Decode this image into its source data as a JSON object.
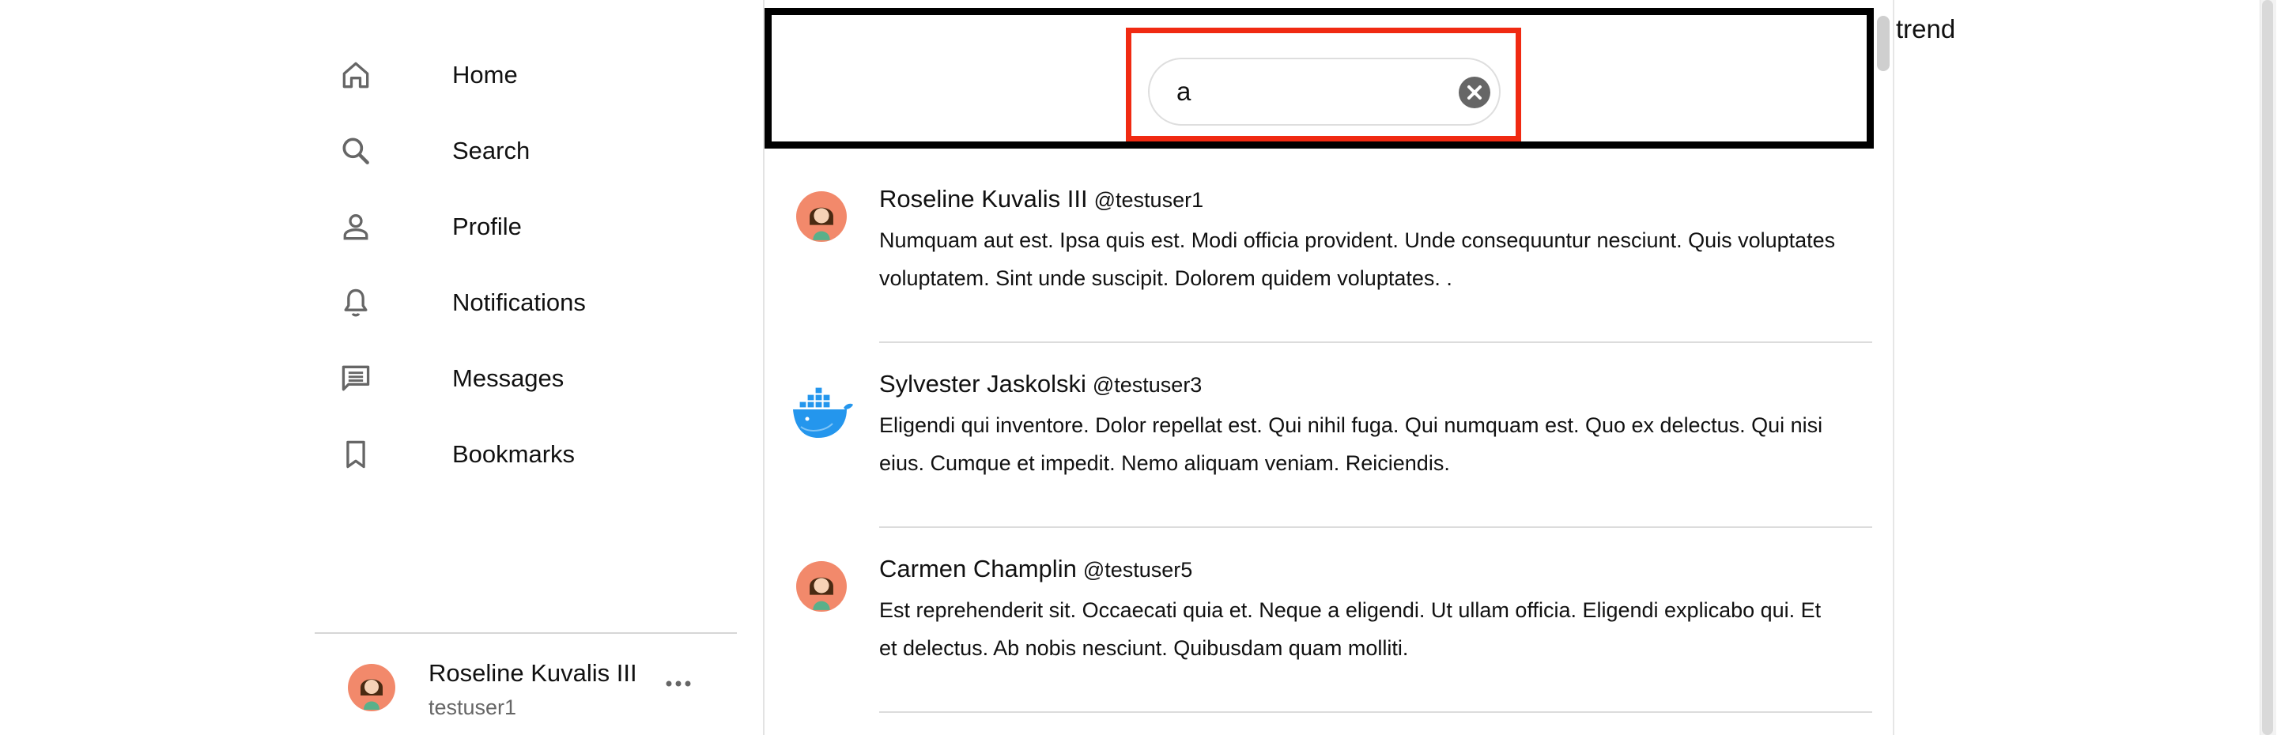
{
  "nav": {
    "items": [
      {
        "label": "Home",
        "icon": "home-icon"
      },
      {
        "label": "Search",
        "icon": "search-icon"
      },
      {
        "label": "Profile",
        "icon": "person-icon"
      },
      {
        "label": "Notifications",
        "icon": "bell-icon"
      },
      {
        "label": "Messages",
        "icon": "message-icon"
      },
      {
        "label": "Bookmarks",
        "icon": "bookmark-icon"
      }
    ]
  },
  "account": {
    "name": "Roseline Kuvalis III",
    "handle": "testuser1",
    "more_icon": "more-horizontal-icon"
  },
  "search": {
    "value": "a",
    "clear_icon": "clear-circle-icon"
  },
  "results": [
    {
      "author": "Roseline Kuvalis III",
      "handle": "@testuser1",
      "avatar": "woman-avatar",
      "text": "Numquam aut est. Ipsa quis est. Modi officia provident. Unde consequuntur nesciunt. Quis voluptates voluptatem. Sint unde suscipit. Dolorem quidem voluptates. ."
    },
    {
      "author": "Sylvester Jaskolski",
      "handle": "@testuser3",
      "avatar": "docker-whale-avatar",
      "text": "Eligendi qui inventore. Dolor repellat est. Qui nihil fuga. Qui numquam est. Quo ex delectus. Qui nisi eius. Cumque et impedit. Nemo aliquam veniam. Reiciendis."
    },
    {
      "author": "Carmen Champlin",
      "handle": "@testuser5",
      "avatar": "woman-avatar",
      "text": "Est reprehenderit sit. Occaecati quia et. Neque a eligendi. Ut ullam officia. Eligendi explicabo qui. Et et delectus. Ab nobis nesciunt. Quibusdam quam molliti."
    }
  ],
  "sidebar_right": {
    "title": "trend"
  },
  "colors": {
    "highlight": "#f02a12",
    "avatar_bg": "#f2896b",
    "whale": "#2496ed"
  }
}
